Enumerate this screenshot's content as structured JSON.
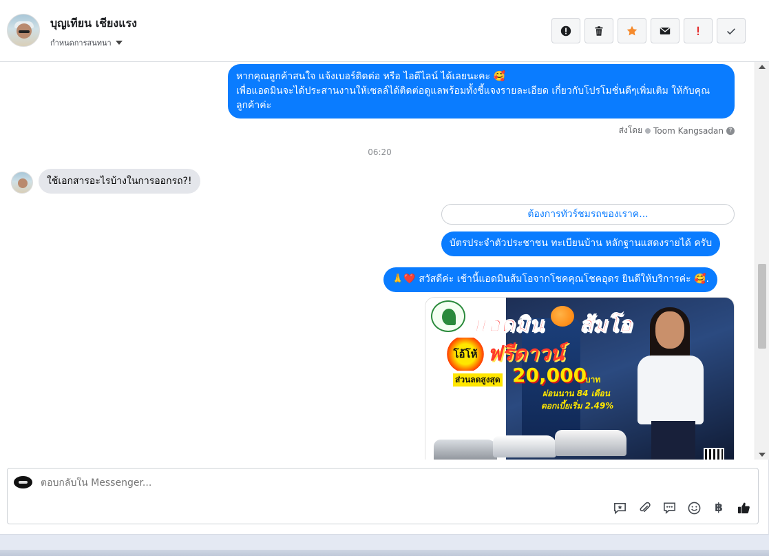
{
  "header": {
    "contact_name": "บุญเทียน เชียงแรง",
    "assign_label": "กำหนดการสนทนา",
    "actions": [
      "spam-icon",
      "trash-icon",
      "star-icon",
      "mail-icon",
      "important-icon",
      "done-icon"
    ],
    "action_colors": {
      "star": "#f58a2d",
      "important": "#e32b2b"
    }
  },
  "conversation": {
    "msg1_line1": "หากคุณลูกค้าสนใจ แจ้งเบอร์ติดต่อ หรือ ไอดีไลน์ ได้เลยนะคะ 🥰",
    "msg1_line2": "เพื่อแอดมินจะได้ประสานงานให้เซลล์ได้ติดต่อดูแลพร้อมทั้งชี้แจงรายละเอียด เกี่ยวกับโปรโมชั่นดีๆเพิ่มเติม ให้กับคุณลูกค้าค่ะ",
    "sent_by_label": "ส่งโดย",
    "sent_by_name": "Toom Kangsadan",
    "timestamp": "06:20",
    "incoming_msg": "ใช้เอกสารอะไรบ้างในการออกรถ?!",
    "quick_reply": "ต้องการทัวร์ชมรถของเราค...",
    "reply_msg": "บัตรประจำตัวประชาชน ทะเบียนบ้าน หลักฐานแสดงรายได้ ครับ",
    "greeting_msg": "🙏❤️ สวัสดีค่ะ เช้านี้แอดมินส้มโอจากโชคคุณโชคอุดร ยินดีให้บริการค่ะ 🥰.",
    "bubble_color": "#0a7cff"
  },
  "promo": {
    "title": "แอดมิน",
    "title2": "ส้มโอ",
    "hot_label": "โอ้โห้",
    "free_label": "ฟรีดาวน์",
    "discount_label": "ส่วนลดสูงสุด",
    "amount": "20,000",
    "currency": "บาท",
    "installment": "ผ่อนนาน 84 เดือน",
    "interest": "ดอกเบี้ยเริ่ม 2.49%"
  },
  "composer": {
    "placeholder": "ตอบกลับใน Messenger...",
    "tools": [
      "saved-reply-icon",
      "attachment-icon",
      "chat-bubbles-icon",
      "emoji-icon",
      "baht-icon",
      "like-icon"
    ],
    "baht_symbol": "฿"
  }
}
